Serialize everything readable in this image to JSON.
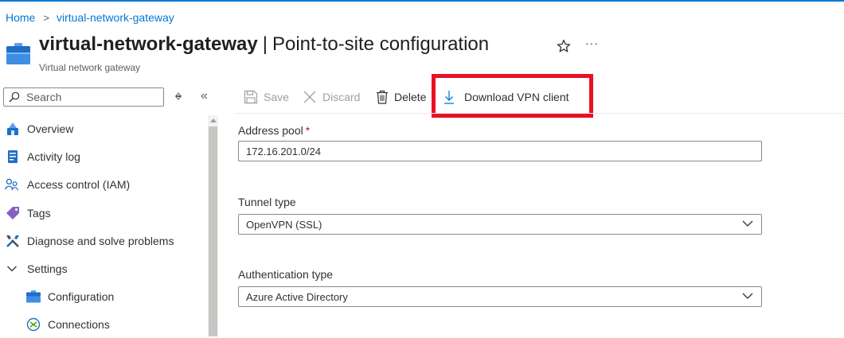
{
  "breadcrumb": {
    "home": "Home",
    "current": "virtual-network-gateway"
  },
  "header": {
    "resource_name": "virtual-network-gateway",
    "separator": "|",
    "page_name": "Point-to-site configuration",
    "resource_type": "Virtual network gateway",
    "more_label": "···",
    "icons": [
      "virtual-network-gateway-icon",
      "star-icon",
      "more-icon"
    ]
  },
  "sidebar": {
    "search_placeholder": "Search",
    "collapse_label": "«",
    "items": [
      {
        "label": "Overview",
        "icon": "overview-icon"
      },
      {
        "label": "Activity log",
        "icon": "activity-log-icon"
      },
      {
        "label": "Access control (IAM)",
        "icon": "iam-icon"
      },
      {
        "label": "Tags",
        "icon": "tag-icon"
      },
      {
        "label": "Diagnose and solve problems",
        "icon": "wrench-icon"
      },
      {
        "label": "Settings",
        "icon": "chevron-down-icon",
        "expanded": true
      },
      {
        "label": "Configuration",
        "icon": "configuration-icon",
        "child": true
      },
      {
        "label": "Connections",
        "icon": "connections-icon",
        "child": true
      }
    ]
  },
  "toolbar": {
    "save": "Save",
    "discard": "Discard",
    "delete": "Delete",
    "download": "Download VPN client",
    "highlighted": "Download VPN client",
    "highlight_color": "#e81123"
  },
  "form": {
    "address_pool": {
      "label": "Address pool",
      "required": "*",
      "value": "172.16.201.0/24"
    },
    "tunnel_type": {
      "label": "Tunnel type",
      "value": "OpenVPN (SSL)"
    },
    "auth_type": {
      "label": "Authentication type",
      "value": "Azure Active Directory"
    }
  },
  "colors": {
    "accent": "#0078d4",
    "text": "#323130",
    "disabled": "#a19f9d",
    "required": "#a4262c"
  }
}
